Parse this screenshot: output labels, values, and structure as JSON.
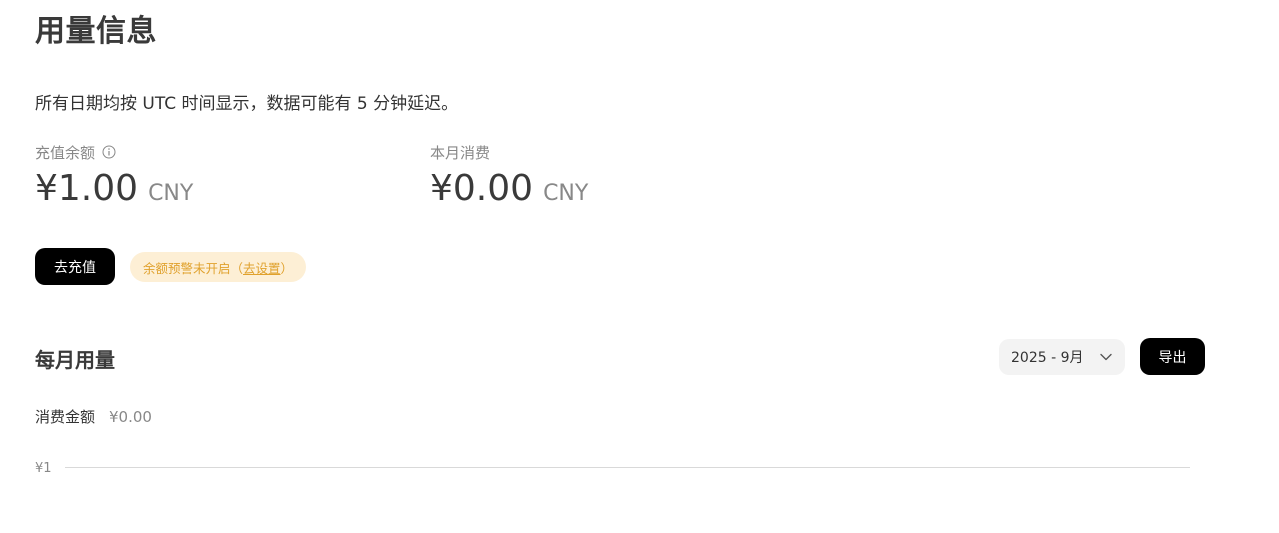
{
  "page": {
    "title": "用量信息",
    "notice": "所有日期均按 UTC 时间显示，数据可能有 5 分钟延迟。"
  },
  "balance": {
    "label": "充值余额",
    "amount": "¥1.00",
    "currency": "CNY",
    "info_icon": "info-circle-icon"
  },
  "monthly_spend": {
    "label": "本月消费",
    "amount": "¥0.00",
    "currency": "CNY"
  },
  "actions": {
    "topup_label": "去充值",
    "alert_text": "余额预警未开启（",
    "alert_link": "去设置",
    "alert_suffix": "）"
  },
  "usage_section": {
    "title": "每月用量",
    "month_selected": "2025 - 9月",
    "export_label": "导出",
    "spend_label": "消费金额",
    "spend_value": "¥0.00"
  },
  "chart_data": {
    "type": "line",
    "title": "",
    "xlabel": "",
    "ylabel": "",
    "y_ticks": [
      "¥1"
    ],
    "series": []
  },
  "colors": {
    "primary_button": "#000000",
    "alert_bg": "#fdefd5",
    "alert_text": "#e0a12c",
    "select_bg": "#f3f3f3",
    "gridline": "#d9d9d9"
  }
}
